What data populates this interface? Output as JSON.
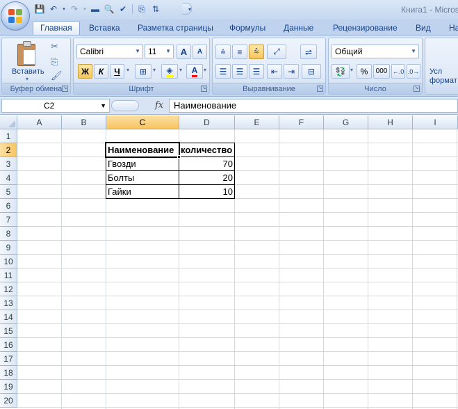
{
  "window": {
    "title": "Книга1 - Micros"
  },
  "tabs": [
    "Главная",
    "Вставка",
    "Разметка страницы",
    "Формулы",
    "Данные",
    "Рецензирование",
    "Вид",
    "На"
  ],
  "ribbon": {
    "clipboard": {
      "label": "Буфер обмена",
      "paste_label": "Вставить"
    },
    "font": {
      "label": "Шрифт",
      "font_name": "Calibri",
      "font_size": "11",
      "bold": "Ж",
      "italic": "К",
      "underline": "Ч",
      "grow": "A",
      "shrink": "A"
    },
    "alignment": {
      "label": "Выравнивание"
    },
    "number": {
      "label": "Число",
      "format": "Общий",
      "percent": "%",
      "thousands": "000"
    },
    "styles": {
      "label_line1": "Усл",
      "label_line2": "формат"
    }
  },
  "formula_bar": {
    "name_box": "C2",
    "fx": "fx",
    "value": "Наименование"
  },
  "sheet": {
    "columns": [
      "A",
      "B",
      "C",
      "D",
      "E",
      "F",
      "G",
      "H",
      "I"
    ],
    "rows": [
      "1",
      "2",
      "3",
      "4",
      "5",
      "6",
      "7",
      "8",
      "9",
      "10",
      "11",
      "12",
      "13",
      "14",
      "15",
      "16",
      "17",
      "18",
      "19",
      "20"
    ],
    "selected_column": "C",
    "selected_row": "2",
    "table": {
      "header": [
        "Наименование",
        "количество"
      ],
      "rows": [
        {
          "name": "Гвозди",
          "qty": "70"
        },
        {
          "name": "Болты",
          "qty": "20"
        },
        {
          "name": "Гайки",
          "qty": "10"
        }
      ]
    }
  },
  "colors": {
    "accent": "#15428b",
    "selection": "#f7c462",
    "gridline": "#d0d7e5"
  }
}
